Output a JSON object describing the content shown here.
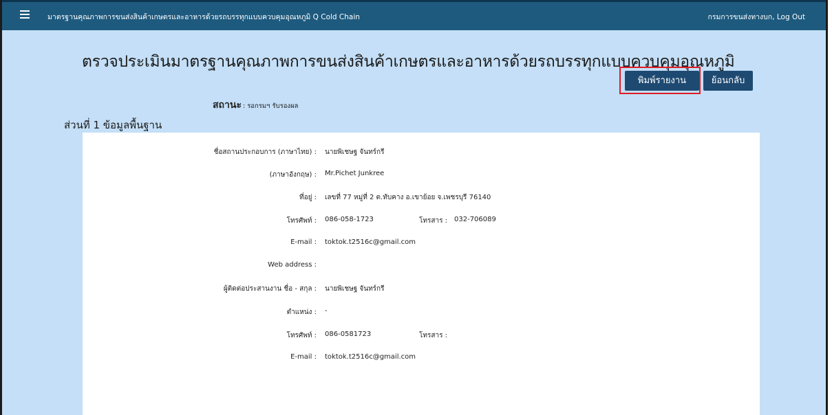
{
  "topbar": {
    "menu_icon": "hamburger-menu-icon",
    "app_title": "มาตรฐานคุณภาพการขนส่งสินค้าเกษตรและอาหารด้วยรถบรรทุกแบบควบคุมอุณหภูมิ Q Cold Chain",
    "user_name": "กรมการขนส่งทางบก",
    "separator": ", ",
    "logout_label": "Log Out"
  },
  "page": {
    "title": "ตรวจประเมินมาตรฐานคุณภาพการขนส่งสินค้าเกษตรและอาหารด้วยรถบรรทุกแบบควบคุมอุณหภูมิ",
    "print_button": "พิมพ์รายงาน",
    "back_button": "ย้อนกลับ",
    "status_label": "สถานะ",
    "status_value": ": รอกรมฯ รับรองผล",
    "section_title": "ส่วนที่ 1 ข้อมูลพื้นฐาน",
    "highlight_color": "#e01b24"
  },
  "info": {
    "operator_name_th_label": "ชื่อสถานประกอบการ (ภาษาไทย) :",
    "operator_name_th": "นายพิเชษฐ จันทร์กรี",
    "operator_name_en_label": "(ภาษาอังกฤษ) :",
    "operator_name_en": "Mr.Pichet Junkree",
    "address_label": "ที่อยู่ :",
    "address": "เลขที่ 77 หมู่ที่ 2 ต.ทับคาง อ.เขาย้อย จ.เพชรบุรี 76140",
    "phone_label": "โทรศัพท์ :",
    "phone": "086-058-1723",
    "fax_label": "โทรสาร :",
    "fax": "032-706089",
    "email_label": "E-mail :",
    "email": "toktok.t2516c@gmail.com",
    "web_label": "Web address :",
    "web": "",
    "contact_label": "ผู้ติดต่อประสานงาน ชื่อ - สกุล :",
    "contact_name": "นายพิเชษฐ จันทร์กรี",
    "position_label": "ตำแหน่ง :",
    "position": "-",
    "contact_phone_label": "โทรศัพท์ :",
    "contact_phone": "086-0581723",
    "contact_fax_label": "โทรสาร :",
    "contact_fax": "",
    "contact_email_label": "E-mail :",
    "contact_email": "toktok.t2516c@gmail.com"
  }
}
